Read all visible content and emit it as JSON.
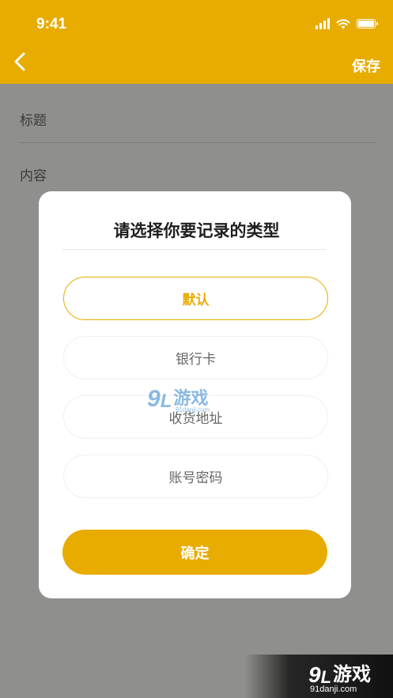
{
  "status_bar": {
    "time": "9:41"
  },
  "nav": {
    "save_label": "保存"
  },
  "form": {
    "title_label": "标题",
    "content_label": "内容"
  },
  "dialog": {
    "title": "请选择你要记录的类型",
    "options": [
      {
        "label": "默认",
        "selected": true
      },
      {
        "label": "银行卡",
        "selected": false
      },
      {
        "label": "收货地址",
        "selected": false
      },
      {
        "label": "账号密码",
        "selected": false
      }
    ],
    "confirm_label": "确定"
  },
  "watermark": {
    "number": "9",
    "brand": "游戏",
    "url": "91danji.com"
  },
  "colors": {
    "accent": "#e8ac00",
    "overlay": "#8f8f8d",
    "dialog_bg": "#ffffff"
  },
  "icons": [
    "back-chevron-icon",
    "cellular-signal-icon",
    "wifi-icon",
    "battery-icon"
  ]
}
